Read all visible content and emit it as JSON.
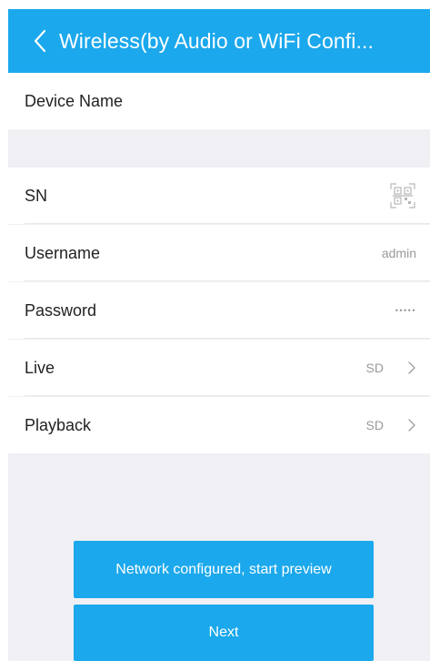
{
  "header": {
    "title": "Wireless(by Audio or WiFi Confi..."
  },
  "form": {
    "device_name_label": "Device Name",
    "sn_label": "SN",
    "username_label": "Username",
    "username_value": "admin",
    "password_label": "Password",
    "password_value": "•••••",
    "live_label": "Live",
    "live_value": "SD",
    "playback_label": "Playback",
    "playback_value": "SD"
  },
  "actions": {
    "start_preview_label": "Network configured, start preview",
    "next_label": "Next"
  },
  "icons": {
    "back": "chevron-left-icon",
    "scan": "qr-scan-icon",
    "disclosure": "chevron-right-icon"
  },
  "colors": {
    "accent": "#1ba8ec",
    "background": "#f0f0f4",
    "row_background": "#ffffff",
    "secondary_text": "#9a9a9a"
  }
}
